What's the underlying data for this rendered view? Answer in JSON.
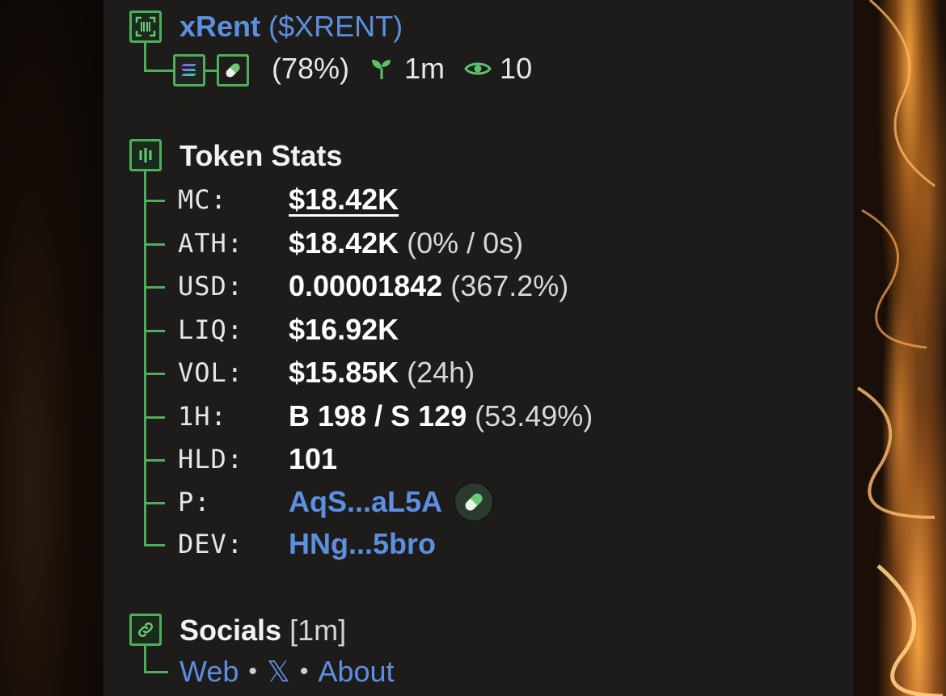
{
  "token": {
    "name": "xRent",
    "ticker": "($XRENT)",
    "percent": "(78%)",
    "age": "1m",
    "watchers": "10"
  },
  "stats": {
    "title": "Token Stats",
    "rows": [
      {
        "label": "MC:",
        "value": "$18.42K",
        "extra": ""
      },
      {
        "label": "ATH:",
        "value": "$18.42K",
        "extra": "(0% / 0s)"
      },
      {
        "label": "USD:",
        "value": "0.00001842",
        "extra": "(367.2%)"
      },
      {
        "label": "LIQ:",
        "value": "$16.92K",
        "extra": ""
      },
      {
        "label": "VOL:",
        "value": "$15.85K",
        "extra": "(24h)"
      },
      {
        "label": "1H:",
        "value": "B 198 / S 129",
        "extra": "(53.49%)"
      },
      {
        "label": "HLD:",
        "value": "101",
        "extra": ""
      },
      {
        "label": "P:",
        "value": "AqS...aL5A",
        "extra": ""
      },
      {
        "label": "DEV:",
        "value": "HNg...5bro",
        "extra": ""
      }
    ]
  },
  "socials": {
    "title": "Socials",
    "age": "[1m]",
    "links": [
      "Web",
      "𝕏",
      "About"
    ],
    "separator": "•"
  },
  "colors": {
    "accent_green": "#4fae5a",
    "link_blue": "#5d8fe0",
    "panel_bg": "#1d1c1a"
  },
  "icons": [
    "qr-scan-icon",
    "solana-icon",
    "pill-icon",
    "sprout-icon",
    "eye-icon",
    "bars-icon",
    "link-icon"
  ]
}
